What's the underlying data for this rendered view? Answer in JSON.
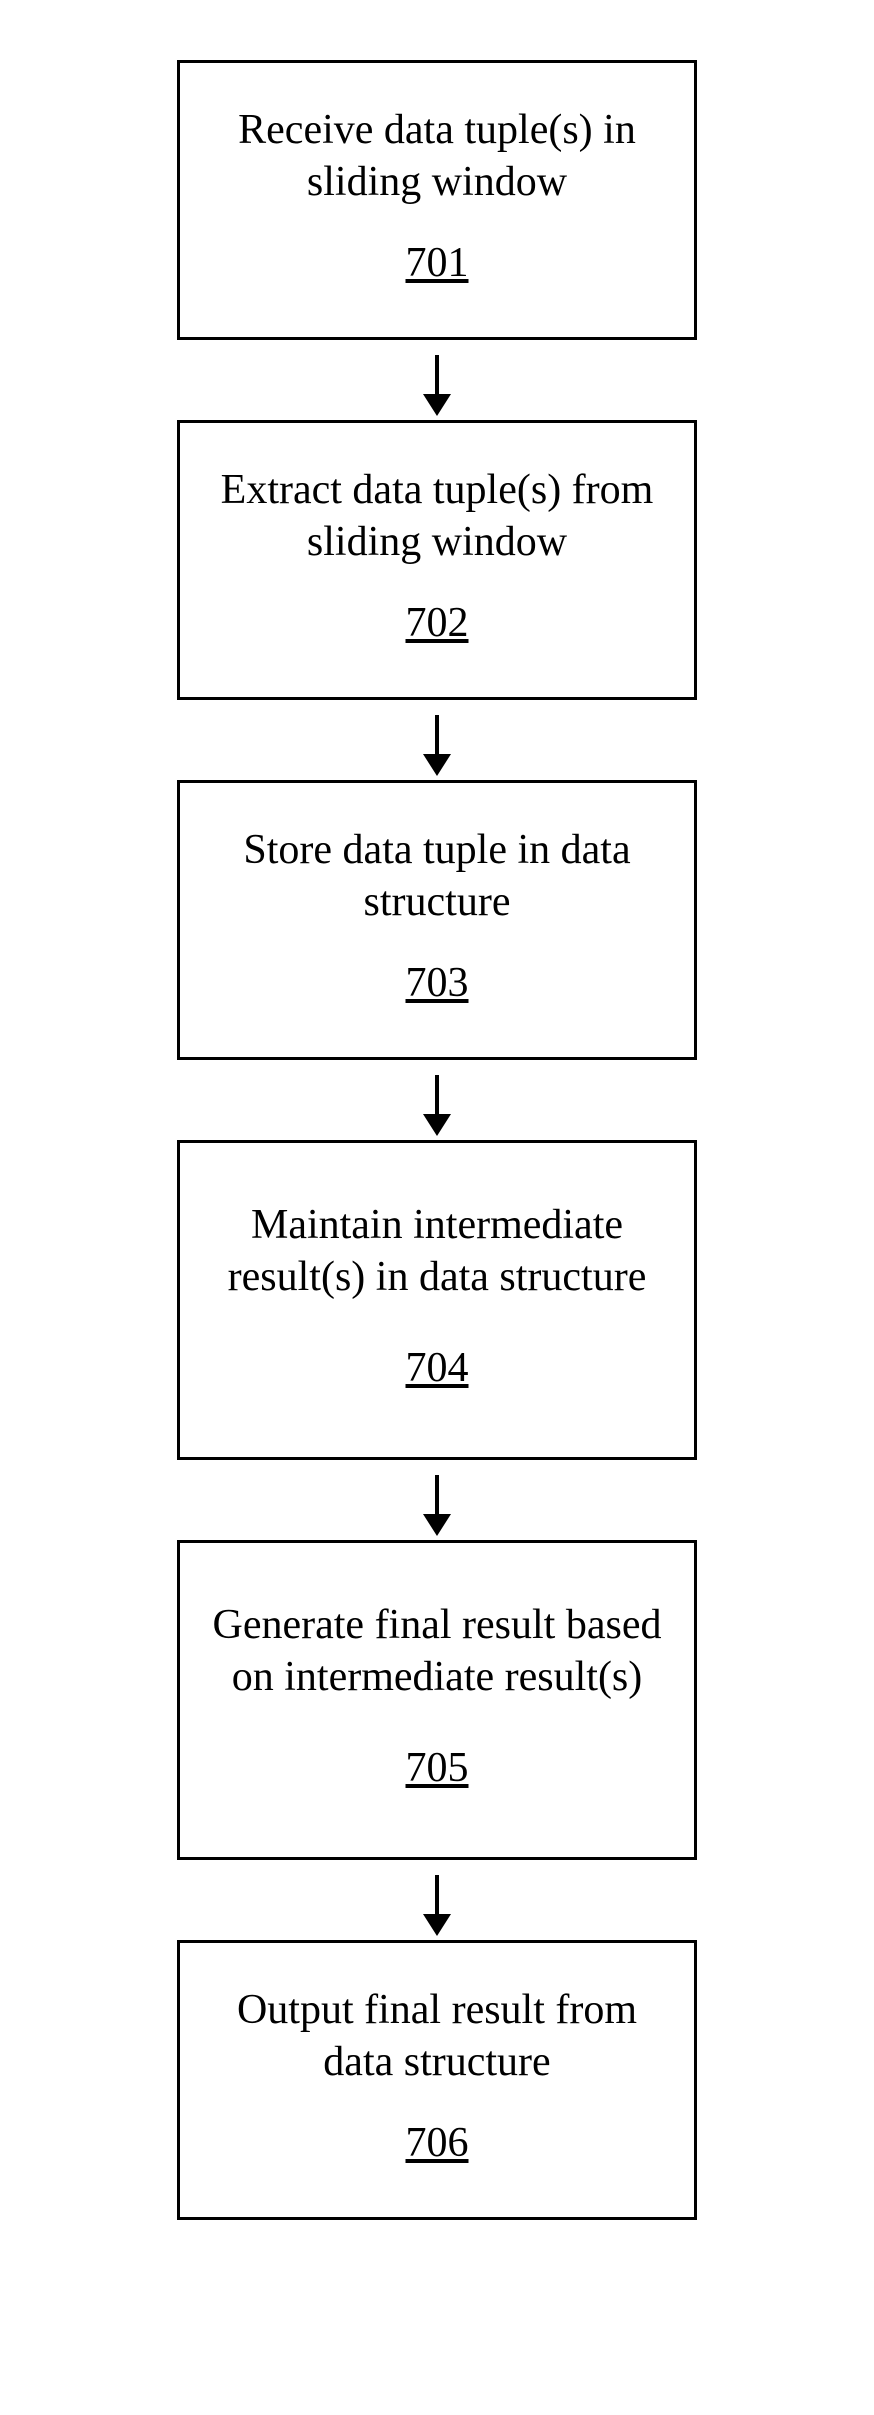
{
  "steps": [
    {
      "desc": "Receive data tuple(s) in sliding window",
      "num": "701"
    },
    {
      "desc": "Extract data tuple(s) from sliding window",
      "num": "702"
    },
    {
      "desc": "Store data tuple in data structure",
      "num": "703"
    },
    {
      "desc": "Maintain intermediate result(s) in data structure",
      "num": "704"
    },
    {
      "desc": "Generate final result based on intermediate result(s)",
      "num": "705"
    },
    {
      "desc": "Output final result from data structure",
      "num": "706"
    }
  ]
}
